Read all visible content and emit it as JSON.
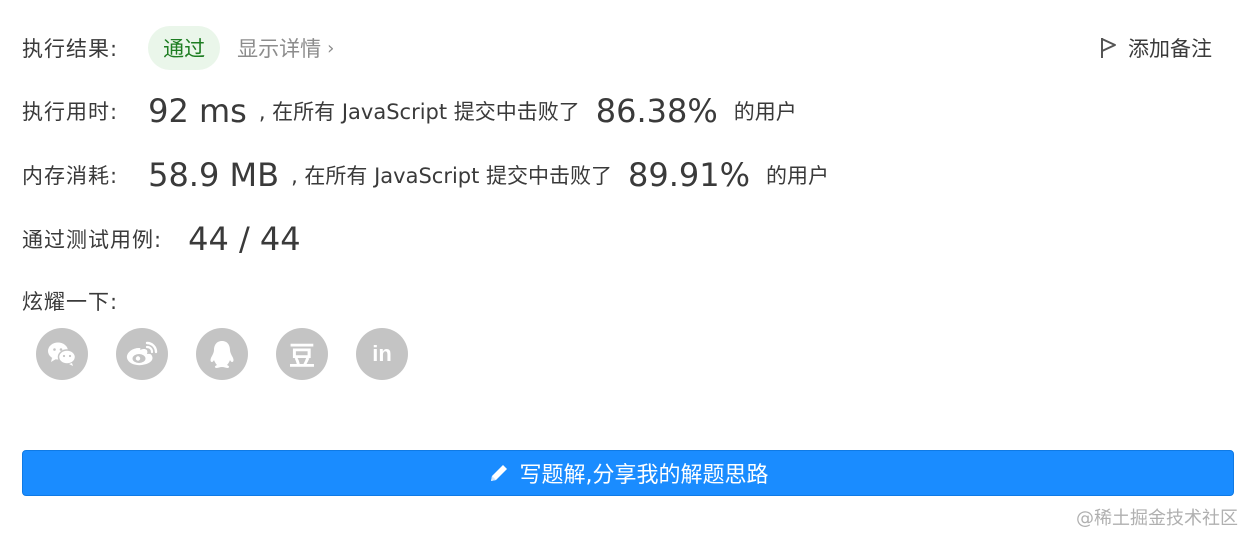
{
  "result": {
    "label": "执行结果:",
    "status": "通过",
    "detail_link": "显示详情"
  },
  "note_button": "添加备注",
  "runtime": {
    "label": "执行用时:",
    "value": "92 ms",
    "middle_text": ", 在所有 JavaScript 提交中击败了",
    "percent": "86.38%",
    "suffix": "的用户"
  },
  "memory": {
    "label": "内存消耗:",
    "value": "58.9 MB",
    "middle_text": ", 在所有 JavaScript 提交中击败了",
    "percent": "89.91%",
    "suffix": "的用户"
  },
  "tests": {
    "label": "通过测试用例:",
    "value": "44 / 44"
  },
  "share": {
    "label": "炫耀一下:",
    "icons": [
      "wechat-icon",
      "weibo-icon",
      "qq-icon",
      "douban-icon",
      "linkedin-icon"
    ],
    "douban_glyph": "豆",
    "linkedin_glyph": "in"
  },
  "write_button": "写题解,分享我的解题思路",
  "watermark": "@稀土掘金技术社区",
  "colors": {
    "accent": "#1a8cff",
    "pass_bg": "#eaf6ea",
    "pass_text": "#1e7d22",
    "share_icon_bg": "#c4c4c4"
  }
}
